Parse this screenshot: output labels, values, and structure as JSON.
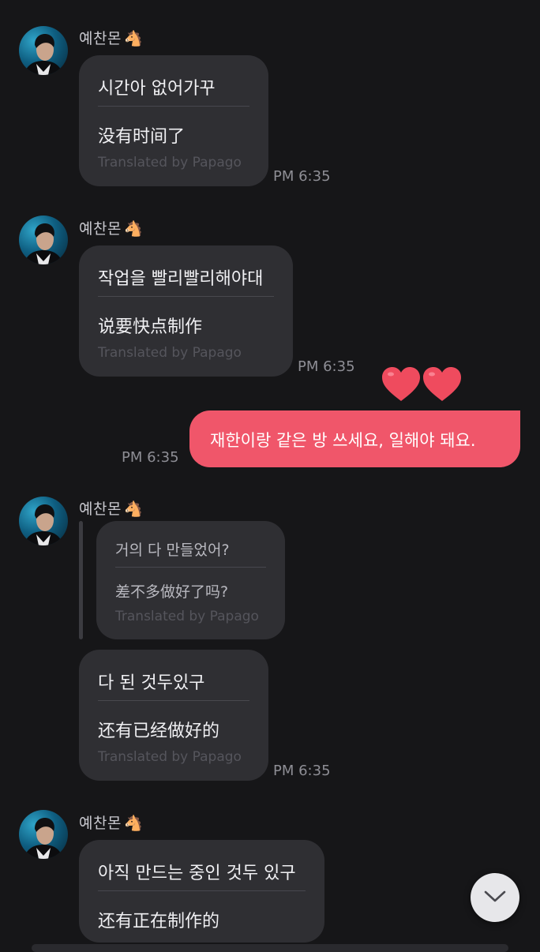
{
  "messages": [
    {
      "sender": "예찬몬",
      "sender_emoji": "🐴",
      "original": "시간아 없어가꾸",
      "translation": "没有时间了",
      "translated_by": "Translated by Papago",
      "time": "PM 6:35"
    },
    {
      "sender": "예찬몬",
      "sender_emoji": "🐴",
      "original": "작업을 빨리빨리해야대",
      "translation": "说要快点制作",
      "translated_by": "Translated by Papago",
      "time": "PM 6:35"
    },
    {
      "mine": true,
      "text": "재한이랑 같은 방 쓰세요, 일해야 돼요.",
      "time": "PM 6:35",
      "reaction": "hearts-icon"
    },
    {
      "sender": "예찬몬",
      "sender_emoji": "🐴",
      "reply_to": {
        "original": "거의 다 만들었어?",
        "translation": "差不多做好了吗?",
        "translated_by": "Translated by Papago"
      },
      "original": "다 된 것두있구",
      "translation": "还有已经做好的",
      "translated_by": "Translated by Papago",
      "time": "PM 6:35"
    },
    {
      "sender": "예찬몬",
      "sender_emoji": "🐴",
      "original": "아직 만드는 중인 것두 있구",
      "translation": "还有正在制作的"
    }
  ],
  "colors": {
    "background": "#161618",
    "bubble": "#2f2f33",
    "my_bubble": "#f0566a",
    "heart": "#ef4b5e"
  },
  "scroll_button_icon": "chevron-down-icon"
}
